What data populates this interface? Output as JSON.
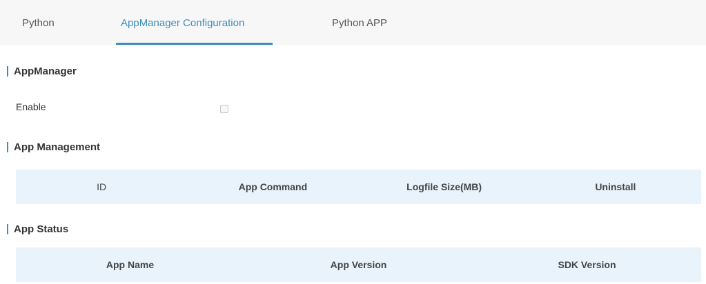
{
  "tabs": [
    {
      "label": "Python",
      "active": false
    },
    {
      "label": "AppManager Configuration",
      "active": true
    },
    {
      "label": "Python APP",
      "active": false
    }
  ],
  "appmanager": {
    "title": "AppManager",
    "enable_label": "Enable",
    "enabled": false
  },
  "app_management": {
    "title": "App Management",
    "columns": [
      "ID",
      "App Command",
      "Logfile Size(MB)",
      "Uninstall"
    ]
  },
  "app_status": {
    "title": "App Status",
    "columns": [
      "App Name",
      "App Version",
      "SDK Version"
    ]
  },
  "colors": {
    "accent": "#3c8dbc",
    "table_header_bg": "#e8f3fb",
    "tabbar_bg": "#f7f7f7"
  }
}
